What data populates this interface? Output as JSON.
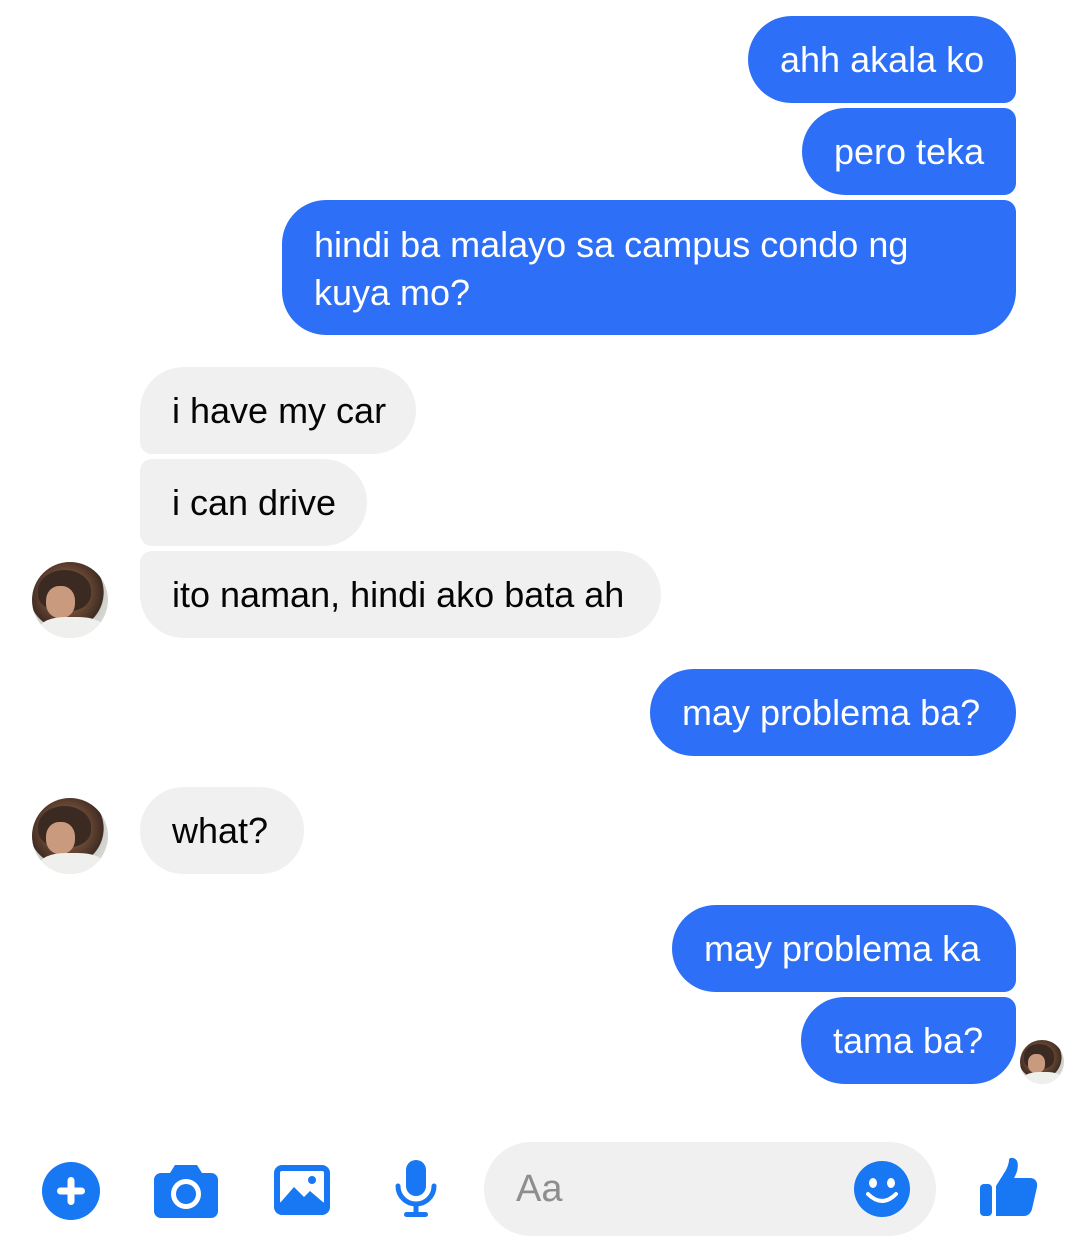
{
  "colors": {
    "sent_bubble": "#2d6ff7",
    "received_bubble": "#f0f0f0",
    "accent": "#1877f2"
  },
  "messages": [
    {
      "direction": "sent",
      "text": "ahh akala ko"
    },
    {
      "direction": "sent",
      "text": "pero teka"
    },
    {
      "direction": "sent",
      "text": "hindi ba malayo sa campus condo ng kuya mo?"
    },
    {
      "direction": "received",
      "text": "i have my car"
    },
    {
      "direction": "received",
      "text": "i can drive"
    },
    {
      "direction": "received",
      "text": "ito naman, hindi ako bata ah"
    },
    {
      "direction": "sent",
      "text": "may problema ba?"
    },
    {
      "direction": "received",
      "text": "what?"
    },
    {
      "direction": "sent",
      "text": "may problema ka"
    },
    {
      "direction": "sent",
      "text": "tama ba?"
    }
  ],
  "composer": {
    "placeholder": "Aa",
    "icons": [
      "plus-icon",
      "camera-icon",
      "gallery-icon",
      "microphone-icon",
      "emoji-icon",
      "thumbs-up-icon"
    ]
  }
}
